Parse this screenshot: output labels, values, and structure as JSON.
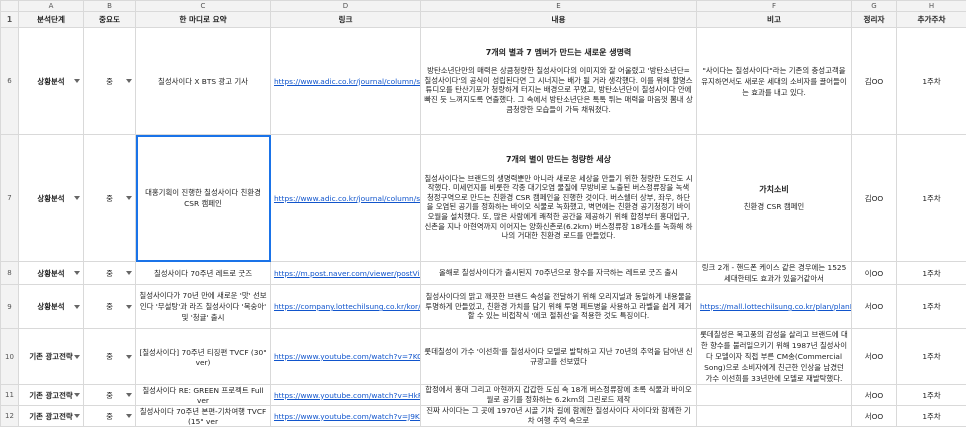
{
  "columns": [
    "A",
    "B",
    "C",
    "D",
    "E",
    "F",
    "G",
    "H"
  ],
  "header": {
    "stage": "분석단계",
    "importance": "중요도",
    "summary": "한 마디로 요약",
    "link": "링크",
    "content": "내용",
    "note": "비고",
    "author": "정리자",
    "week": "추가주차"
  },
  "rows": [
    {
      "num": "6",
      "stage": "상황분석",
      "importance": "중",
      "summary": "칠성사이다 X BTS 광고 기사",
      "link": "https://www.adic.co.kr/journal/column/show.do?ukey=",
      "content_title": "7개의 별과 7 멤버가 만드는 새로운 생명력",
      "content": "방탄소년단만의 매력은 상큼청량한 칠성사이다의 이미지와 잘 어울렸고 '방탄소년단=칠성사이다'의 공식이 성립된다면 그 시너지는 배가 될 거라 생각했다. 이를 위해 할명스튜디오를 탄산기포가 청량하게 터지는 배경으로 꾸몄고, 방탄소년단이 칠성사이다 안에 빠진 듯 느껴지도록 연출했다. 그 속에서 방탄소년단은 톡톡 튀는 매력을 마음껏 뽐내 상큼청량한 모습들이 가득 채워졌다.",
      "note_bold": "",
      "note": "\"사이다는 칠성사이다\"라는 기존의 충성고객을 유지하면서도 새로운 세대의 소비자를 끌어들이는 효과를 내고 있다.",
      "author": "김OO",
      "week": "1주차"
    },
    {
      "num": "7",
      "stage": "상황분석",
      "importance": "중",
      "summary": "대홍기획이 진행한 칠성사이다 친환경 CSR 캠페인",
      "link": "https://www.adic.co.kr/journal/column/show.do?ukey=",
      "content_title": "7개의 별이 만드는 청량한 세상",
      "content": "칠성사이다는 브랜드의 생명력뿐만 아니라 새로운 세상을 만들기 위한 청량한 도전도 시작했다. 미세먼지를 비롯한 각종 대기오염 물질에 무방비로 노출된 버스정류장을 녹색 청정구역으로 만드는 친환경 CSR 캠페인을 진행한 것이다. 버스쉘터 상부, 좌우, 하단을 오염된 공기를 정화하는 바이오 식물로 녹화했고, 벽면에는 친환경 공기청정기 바이오월을 설치했다. 또, 많은 사람에게 쾌적한 공간을 제공하기 위해 합정부터 홍대입구, 신촌을 지나 아현역까지 이어지는 양화신촌로(6.2km) 버스정류장 18개소를 녹화해 하나의 거대한 친환경 로드를 만들었다.",
      "note_bold": "가치소비",
      "note": "친환경 CSR 캠페인",
      "author": "김OO",
      "week": "1주차"
    },
    {
      "num": "8",
      "stage": "상황분석",
      "importance": "중",
      "summary": "칠성사이다 70주년 레트로 굿즈",
      "link": "https://m.post.naver.com/viewer/postView.naver?volu",
      "content_title": "",
      "content": "올해로 칠성사이다가 출시된지 70주년으로 향수를 자극하는 레트로 굿즈 출시",
      "note_bold": "",
      "note": "링크 2개 - 핸드폰 케이스 같은 경우에는 1525세대한테도 효과가 있을거같아서",
      "author": "이OO",
      "week": "1주차"
    },
    {
      "num": "9",
      "stage": "상황분석",
      "importance": "중",
      "summary": "칠성사이다가 70년 만에 새로운 '맛' 선보인다 '무설탕'과 라즈 칠성사이다 '복숭아' 및 '청귤' 출시",
      "link": "https://company.lottechilsung.co.kr/kor/company/pr",
      "content_title": "",
      "content": "칠성사이다의 맑고 깨끗한 브랜드 속성을 전달하기 위해 오리지널과 동일하게 내용물을 투명하게 만들었고, 친환경 가치를 담기 위해 투명 페트병을 사용하고 라벨을 쉽게 제거할 수 있는 비접착식 '에코 절취선'을 적용한 것도 특징이다.",
      "note_bold": "",
      "note": "https://mall.lottechilsung.co.kr/plan/planEventDetail.Disp.lecs?plan_no=",
      "author": "서OO",
      "week": "1주차"
    },
    {
      "num": "10",
      "stage": "기존 광고전략",
      "importance": "중",
      "summary": "[칠성사이다] 70주년 티징편 TVCF (30\" ver)",
      "link": "https://www.youtube.com/watch?v=7KOeyRS1QiA",
      "content_title": "",
      "content": "롯데칠성이 가수 '이선희'를 칠성사이다 모델로 발탁하고 지난 70년의 추억을 담아낸 신규광고를 선보였다",
      "note_bold": "",
      "note": "롯데칠성은 복고풍의 감성을 살리고 브랜드에 대한 향수를 불러일으키기 위해 1987년 칠성사이다 모델이자 직접 부른 CM송(Commercial Song)으로 소비자에게 친근한 인상을 남겼던 가수 이선희를 33년만에 모델로 재발탁했다.",
      "author": "서OO",
      "week": "1주차"
    },
    {
      "num": "11",
      "stage": "기존 광고전략",
      "importance": "중",
      "summary": "칠성사이다 RE: GREEN 프로젝트 Full ver",
      "link": "https://www.youtube.com/watch?v=HkRKc3e0c8",
      "content_title": "",
      "content": "합정에서 홍대 그리고 아현까지 갑갑한 도심 속 18개 버스정류장에 초록 식물과 바이오월로 공기를 정화하는 6.2km의 그린로드 제작",
      "note_bold": "",
      "note": "",
      "author": "서OO",
      "week": "1주차"
    },
    {
      "num": "12",
      "stage": "기존 광고전략",
      "importance": "중",
      "summary": "칠성사이다 70주년 본편-기차여행 TVCF (15\" ver",
      "link": "https://www.youtube.com/watch?v=J9KFqw7e1cQ",
      "content_title": "",
      "content": "진짜 사이다는 그 곳에 1970년 시골 기차 길에 함께한 칠성사이다 사이다와 함께한 기차 여행 추억 속으로",
      "note_bold": "",
      "note": "",
      "author": "서OO",
      "week": "1주차"
    }
  ]
}
